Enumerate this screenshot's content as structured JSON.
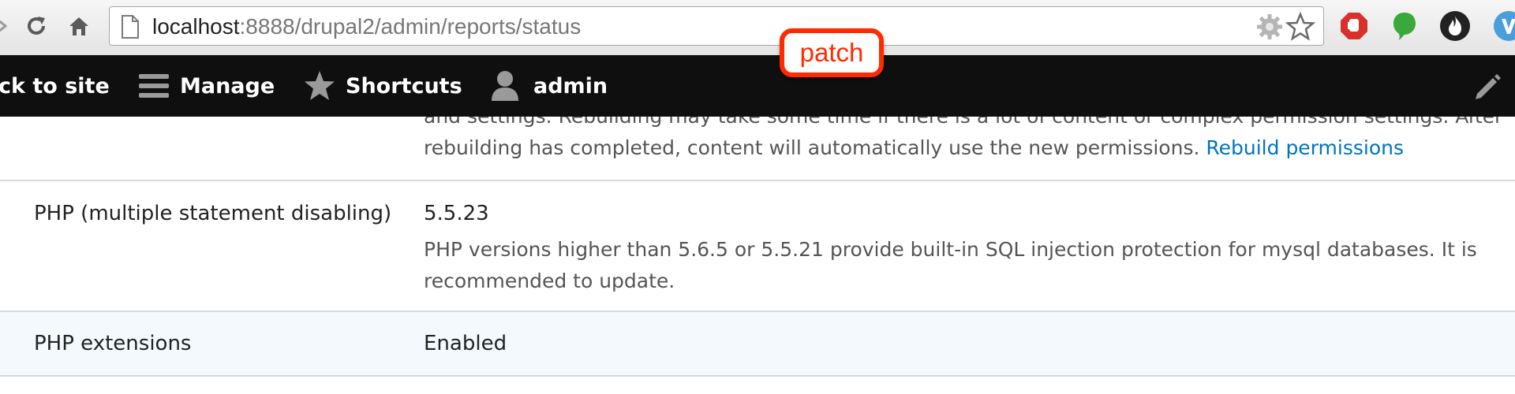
{
  "browser": {
    "url_host": "localhost",
    "url_path": ":8888/drupal2/admin/reports/status"
  },
  "annotation": {
    "label": "patch",
    "color": "#ff2a00"
  },
  "toolbar": {
    "back_label": "ck to site",
    "manage_label": "Manage",
    "shortcuts_label": "Shortcuts",
    "user_label": "admin"
  },
  "status_rows": {
    "permissions": {
      "line1": "and settings. Rebuilding may take some time if there is a lot of content or complex permission settings. After",
      "line2": "rebuilding has completed, content will automatically use the new permissions.",
      "link": "Rebuild permissions"
    },
    "php_multi": {
      "label": "PHP (multiple statement disabling)",
      "value": "5.5.23",
      "desc": "PHP versions higher than 5.6.5 or 5.5.21 provide built-in SQL injection protection for mysql databases. It is recommended to update."
    },
    "php_ext": {
      "label": "PHP extensions",
      "value": "Enabled"
    }
  },
  "colors": {
    "toolbar_bg": "#0f0f0f",
    "link": "#0074bd",
    "highlight_row": "#f3f9fc"
  }
}
